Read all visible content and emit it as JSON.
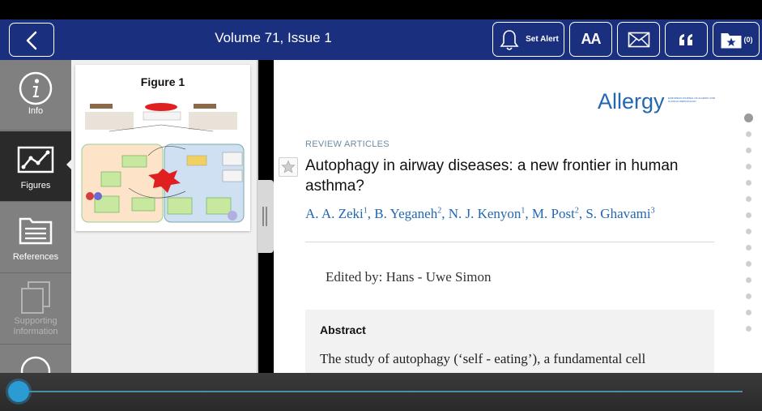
{
  "header": {
    "title": "Volume 71, Issue 1",
    "set_alert_label": "Set Alert",
    "font_size_label": "AA",
    "saved_count": "(0)"
  },
  "sidebar": {
    "items": [
      {
        "label": "Info",
        "icon": "info-icon",
        "state": "normal"
      },
      {
        "label": "Figures",
        "icon": "chart-icon",
        "state": "active"
      },
      {
        "label": "References",
        "icon": "folder-list-icon",
        "state": "normal"
      },
      {
        "label": "Supporting Information",
        "icon": "copy-pages-icon",
        "state": "disabled"
      },
      {
        "label": "",
        "icon": "circle-icon",
        "state": "normal"
      }
    ]
  },
  "figures": {
    "items": [
      {
        "title": "Figure 1"
      }
    ]
  },
  "article": {
    "journal": "Allergy",
    "journal_subtitle": "EUROPEAN JOURNAL OF ALLERGY AND CLINICAL IMMUNOLOGY",
    "section": "REVIEW ARTICLES",
    "title": "Autophagy in airway diseases: a new frontier in human asthma?",
    "authors": [
      {
        "name": "A. A. Zeki",
        "aff": "1"
      },
      {
        "name": "B. Yeganeh",
        "aff": "2"
      },
      {
        "name": "N. J. Kenyon",
        "aff": "1"
      },
      {
        "name": "M. Post",
        "aff": "2"
      },
      {
        "name": "S. Ghavami",
        "aff": "3"
      }
    ],
    "edited_by": "Edited by: Hans ‐ Uwe Simon",
    "abstract_heading": "Abstract",
    "abstract_text": "The study of autophagy (‘self ‐ eating’), a fundamental cell"
  },
  "page_dots": {
    "count": 15,
    "active": 0
  },
  "scrubber": {
    "progress": 0.0
  },
  "colors": {
    "header_bg": "#1a2f7e",
    "sidebar_bg": "#808080",
    "sidebar_active": "#2a2a2a",
    "link_blue": "#2267b1",
    "accent": "#2b9bd3"
  }
}
